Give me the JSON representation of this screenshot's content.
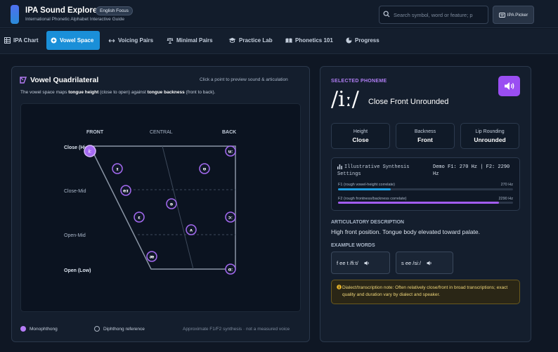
{
  "header": {
    "title": "IPA Sound Explorer",
    "badge": "English Focus",
    "subtitle": "International Phonetic Alphabet Interactive Guide",
    "search_placeholder": "Search symbol, word or feature; p",
    "picker_label": "IPA Picker"
  },
  "nav": {
    "tabs": [
      {
        "label": "IPA Chart",
        "icon": "table-icon"
      },
      {
        "label": "Vowel Space",
        "icon": "plus-circle-icon",
        "active": true
      },
      {
        "label": "Voicing Pairs",
        "icon": "arrows-icon"
      },
      {
        "label": "Minimal Pairs",
        "icon": "scale-icon"
      },
      {
        "label": "Practice Lab",
        "icon": "graduation-cap-icon"
      },
      {
        "label": "Phonetics 101",
        "icon": "book-icon"
      },
      {
        "label": "Progress",
        "icon": "pie-chart-icon"
      }
    ]
  },
  "vowel": {
    "title": "Vowel Quadrilateral",
    "hint": "Click a point to preview sound & articulation",
    "desc_pre": "The vowel space maps ",
    "desc_b1": "tongue height",
    "desc_mid": " (close to open) against ",
    "desc_b2": "tongue backness",
    "desc_post": " (front to back).",
    "cols": {
      "front": "FRONT",
      "central": "CENTRAL",
      "back": "BACK"
    },
    "rows": {
      "close": "Close (High)",
      "close_mid": "Close-Mid",
      "open_mid": "Open-Mid",
      "open": "Open (Low)"
    },
    "points": [
      {
        "symbol": "iː",
        "active": true
      },
      {
        "symbol": "ɪ"
      },
      {
        "symbol": "uː"
      },
      {
        "symbol": "ʊ"
      },
      {
        "symbol": "eɪ"
      },
      {
        "symbol": "ə"
      },
      {
        "symbol": "ɛ"
      },
      {
        "symbol": "ɔː"
      },
      {
        "symbol": "ʌ"
      },
      {
        "symbol": "æ"
      },
      {
        "symbol": "ɑː"
      }
    ],
    "legend": {
      "mono": "Monophthong",
      "diph": "Diphthong reference",
      "note": "Approximate F1/F2 synthesis · not a measured voice"
    }
  },
  "phoneme": {
    "label": "SELECTED PHONEME",
    "symbol": "/iː/",
    "name": "Close Front Unrounded",
    "attrs": [
      {
        "key": "Height",
        "value": "Close"
      },
      {
        "key": "Backness",
        "value": "Front"
      },
      {
        "key": "Lip Rounding",
        "value": "Unrounded"
      }
    ],
    "synth": {
      "title": "Illustrative Synthesis Settings",
      "readout": "Demo F1: 270 Hz | F2: 2290 Hz",
      "f1_label": "F1 (rough vowel-height correlate)",
      "f1_value": "270 Hz",
      "f1_fraction": 0.3,
      "f2_label": "F2 (rough frontness/backness correlate)",
      "f2_value": "2290 Hz",
      "f2_fraction": 0.92
    },
    "articulatory_h": "ARTICULATORY DESCRIPTION",
    "articulatory": "High front position. Tongue body elevated toward palate.",
    "examples_h": "EXAMPLE WORDS",
    "examples": [
      "f ee t /fiːt/",
      "s ee /siː/"
    ],
    "note": "Dialect/transcription note: Often relatively close/front in broad transcriptions; exact quality and duration vary by dialect and speaker.",
    "colors": {
      "accent": "#9a4ef2",
      "f1": "#1e9ee0",
      "f2": "#a25cf0"
    }
  }
}
